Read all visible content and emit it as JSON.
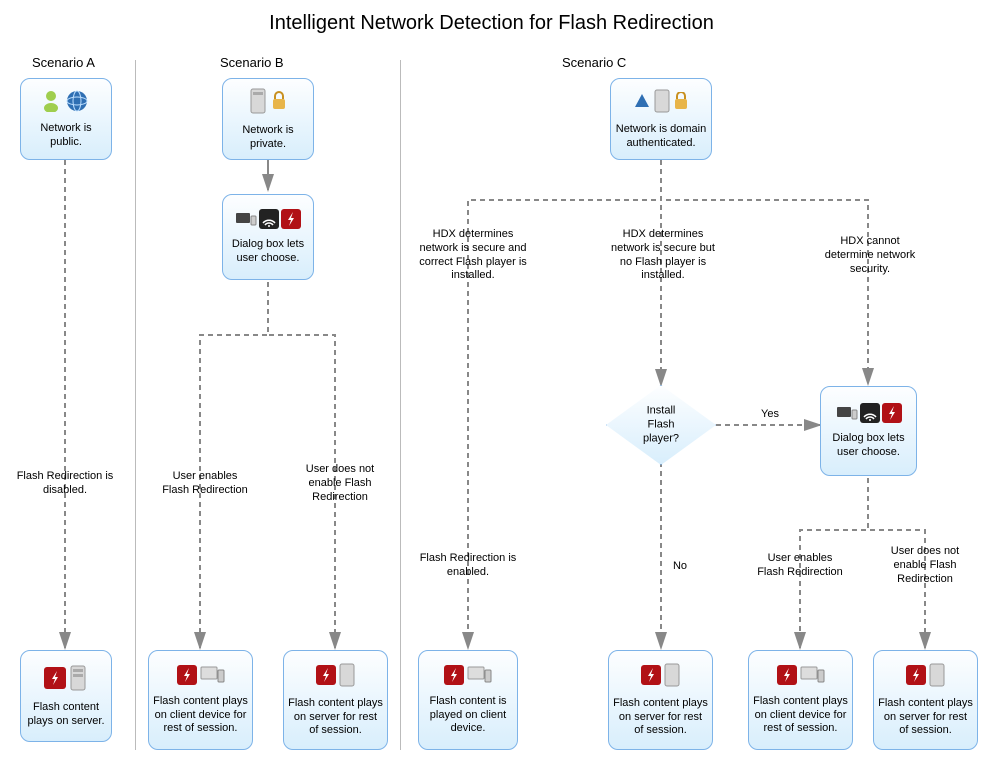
{
  "title": "Intelligent Network Detection for Flash Redirection",
  "scenarios": {
    "a": {
      "label": "Scenario A"
    },
    "b": {
      "label": "Scenario B"
    },
    "c": {
      "label": "Scenario C"
    }
  },
  "nodes": {
    "a_start": "Network is public.",
    "a_end": "Flash content plays on server.",
    "b_start": "Network is private.",
    "b_dialog": "Dialog box lets user choose.",
    "b_end_left": "Flash content plays on client device for rest of session.",
    "b_end_right": "Flash content plays on server for rest of session.",
    "c_start": "Network is domain authenticated.",
    "c_decision": "Install Flash player?",
    "c_dialog": "Dialog box lets user choose.",
    "c_end_1": "Flash content is played on client device.",
    "c_end_2": "Flash content plays on server for rest of session.",
    "c_end_3": "Flash content plays on client device for rest of session.",
    "c_end_4": "Flash content plays on server for rest of session."
  },
  "edges": {
    "a_mid": "Flash Redirection is disabled.",
    "b_left": "User enables Flash Redirection",
    "b_right": "User does not enable Flash Redirection",
    "c_branch1": "HDX determines network is secure and correct Flash player is installed.",
    "c_branch2": "HDX determines network is secure but no Flash player is installed.",
    "c_branch3": "HDX cannot determine network security.",
    "c_mid1": "Flash Redirection is enabled.",
    "c_yes": "Yes",
    "c_no": "No",
    "c_left": "User enables Flash Redirection",
    "c_right": "User does not enable Flash Redirection"
  }
}
